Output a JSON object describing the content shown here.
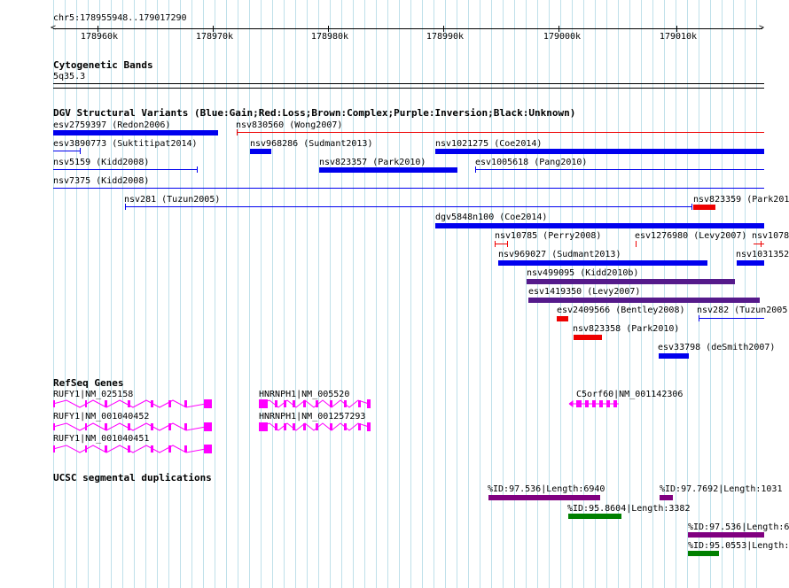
{
  "ruler": {
    "region": "chr5:178955948..179017290",
    "ticks": [
      "178960k",
      "178970k",
      "178980k",
      "178990k",
      "179000k",
      "179010k"
    ]
  },
  "tracks": {
    "cyto": {
      "title": "Cytogenetic Bands",
      "band": "5q35.3"
    },
    "dgv": {
      "title": "DGV Structural Variants (Blue:Gain;Red:Loss;Brown:Complex;Purple:Inversion;Black:Unknown)",
      "features": [
        {
          "label": "esv2759397 (Redon2006)",
          "type": "gain",
          "shape": "bar"
        },
        {
          "label": "nsv830560 (Wong2007)",
          "type": "loss",
          "shape": "line"
        },
        {
          "label": "esv3890773 (Suktitipat2014)",
          "type": "gain",
          "shape": "line"
        },
        {
          "label": "nsv968286 (Sudmant2013)",
          "type": "gain",
          "shape": "bar"
        },
        {
          "label": "nsv1021275 (Coe2014)",
          "type": "gain",
          "shape": "bar"
        },
        {
          "label": "nsv5159 (Kidd2008)",
          "type": "gain",
          "shape": "line"
        },
        {
          "label": "nsv823357 (Park2010)",
          "type": "gain",
          "shape": "bar"
        },
        {
          "label": "esv1005618 (Pang2010)",
          "type": "gain",
          "shape": "line"
        },
        {
          "label": "nsv7375 (Kidd2008)",
          "type": "gain",
          "shape": "line"
        },
        {
          "label": "nsv281 (Tuzun2005)",
          "type": "gain",
          "shape": "line"
        },
        {
          "label": "nsv823359 (Park201",
          "type": "loss",
          "shape": "bar"
        },
        {
          "label": "dgv5848n100 (Coe2014)",
          "type": "gain",
          "shape": "bar"
        },
        {
          "label": "nsv10785 (Perry2008)",
          "type": "loss",
          "shape": "line"
        },
        {
          "label": "esv1276980 (Levy2007)",
          "type": "loss",
          "shape": "line"
        },
        {
          "label": "nsv1078",
          "type": "loss",
          "shape": "line"
        },
        {
          "label": "nsv969027 (Sudmant2013)",
          "type": "gain",
          "shape": "bar"
        },
        {
          "label": "nsv1031352",
          "type": "gain",
          "shape": "bar"
        },
        {
          "label": "nsv499095 (Kidd2010b)",
          "type": "inversion",
          "shape": "bar"
        },
        {
          "label": "esv1419350 (Levy2007)",
          "type": "inversion",
          "shape": "bar"
        },
        {
          "label": "esv2409566 (Bentley2008)",
          "type": "loss",
          "shape": "bar"
        },
        {
          "label": "nsv282 (Tuzun2005",
          "type": "gain",
          "shape": "line"
        },
        {
          "label": "nsv823358 (Park2010)",
          "type": "loss",
          "shape": "bar"
        },
        {
          "label": "esv33798 (deSmith2007)",
          "type": "gain",
          "shape": "bar"
        }
      ]
    },
    "refseq": {
      "title": "RefSeq Genes",
      "genes": [
        {
          "label": "RUFY1|NM_025158"
        },
        {
          "label": "RUFY1|NM_001040452"
        },
        {
          "label": "RUFY1|NM_001040451"
        },
        {
          "label": "HNRNPH1|NM_005520"
        },
        {
          "label": "HNRNPH1|NM_001257293"
        },
        {
          "label": "C5orf60|NM_001142306"
        }
      ]
    },
    "segdup": {
      "title": "UCSC segmental duplications",
      "features": [
        {
          "label": "%ID:97.536|Length:6940"
        },
        {
          "label": "%ID:97.7692|Length:1031"
        },
        {
          "label": "%ID:95.8604|Length:3382"
        },
        {
          "label": "%ID:97.536|Length:6"
        },
        {
          "label": "%ID:95.0553|Length:"
        }
      ]
    }
  },
  "colors": {
    "gain": "#0000ee",
    "loss": "#ee0000",
    "inversion": "#551a8b",
    "gene": "#ff00ff",
    "segdup_high": "#800080",
    "segdup_mid": "#008000",
    "grid": "#bfe0ea"
  }
}
